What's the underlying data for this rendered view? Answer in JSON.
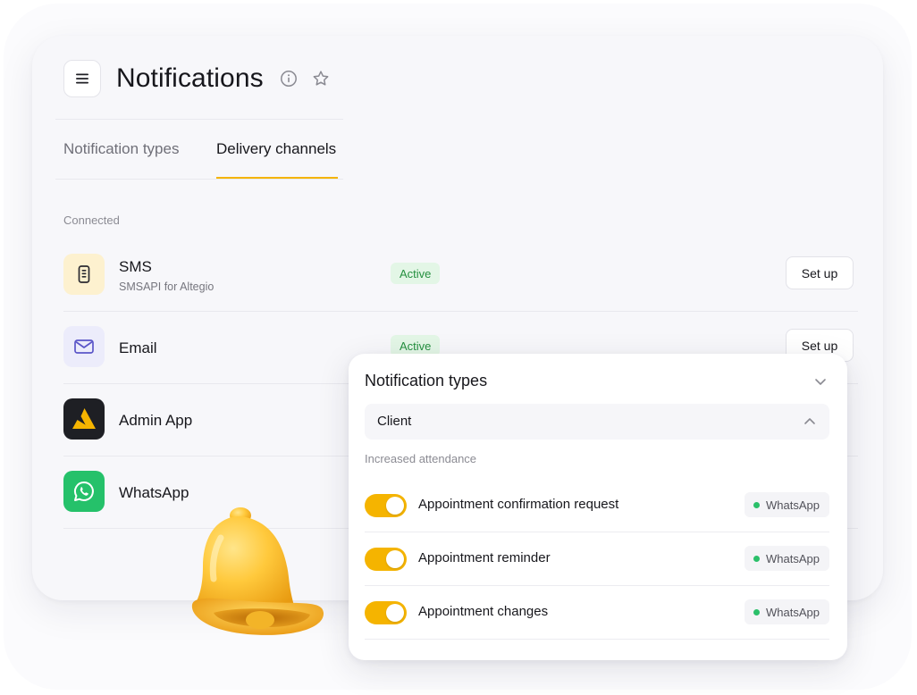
{
  "header": {
    "title": "Notifications",
    "menu_icon": "hamburger-menu-icon",
    "info_icon": "info-icon",
    "favorite_icon": "star-icon"
  },
  "tabs": [
    {
      "label": "Notification types",
      "active": false
    },
    {
      "label": "Delivery channels",
      "active": true
    }
  ],
  "section": {
    "label": "Connected"
  },
  "channels": [
    {
      "name": "SMS",
      "subtitle": "SMSAPI for Altegio",
      "status": "Active",
      "action": "Set up",
      "icon": "phone-icon"
    },
    {
      "name": "Email",
      "subtitle": "",
      "status": "Active",
      "action": "Set up",
      "icon": "mail-icon"
    },
    {
      "name": "Admin App",
      "icon": "admin-app-logo-icon"
    },
    {
      "name": "WhatsApp",
      "icon": "whatsapp-icon"
    }
  ],
  "panel": {
    "title": "Notification types",
    "selected_group": "Client",
    "group_label": "Increased attendance",
    "items": [
      {
        "label": "Appointment confirmation request",
        "enabled": true,
        "channel": "WhatsApp"
      },
      {
        "label": "Appointment reminder",
        "enabled": true,
        "channel": "WhatsApp"
      },
      {
        "label": "Appointment changes",
        "enabled": true,
        "channel": "WhatsApp"
      }
    ]
  },
  "decoration": {
    "bell_icon": "bell-icon"
  },
  "colors": {
    "accent": "#f5b400",
    "active_badge_bg": "#e3f6e6",
    "active_badge_text": "#25903f",
    "whatsapp_green": "#25c16a",
    "admin_app_bg": "#1e1f24"
  }
}
